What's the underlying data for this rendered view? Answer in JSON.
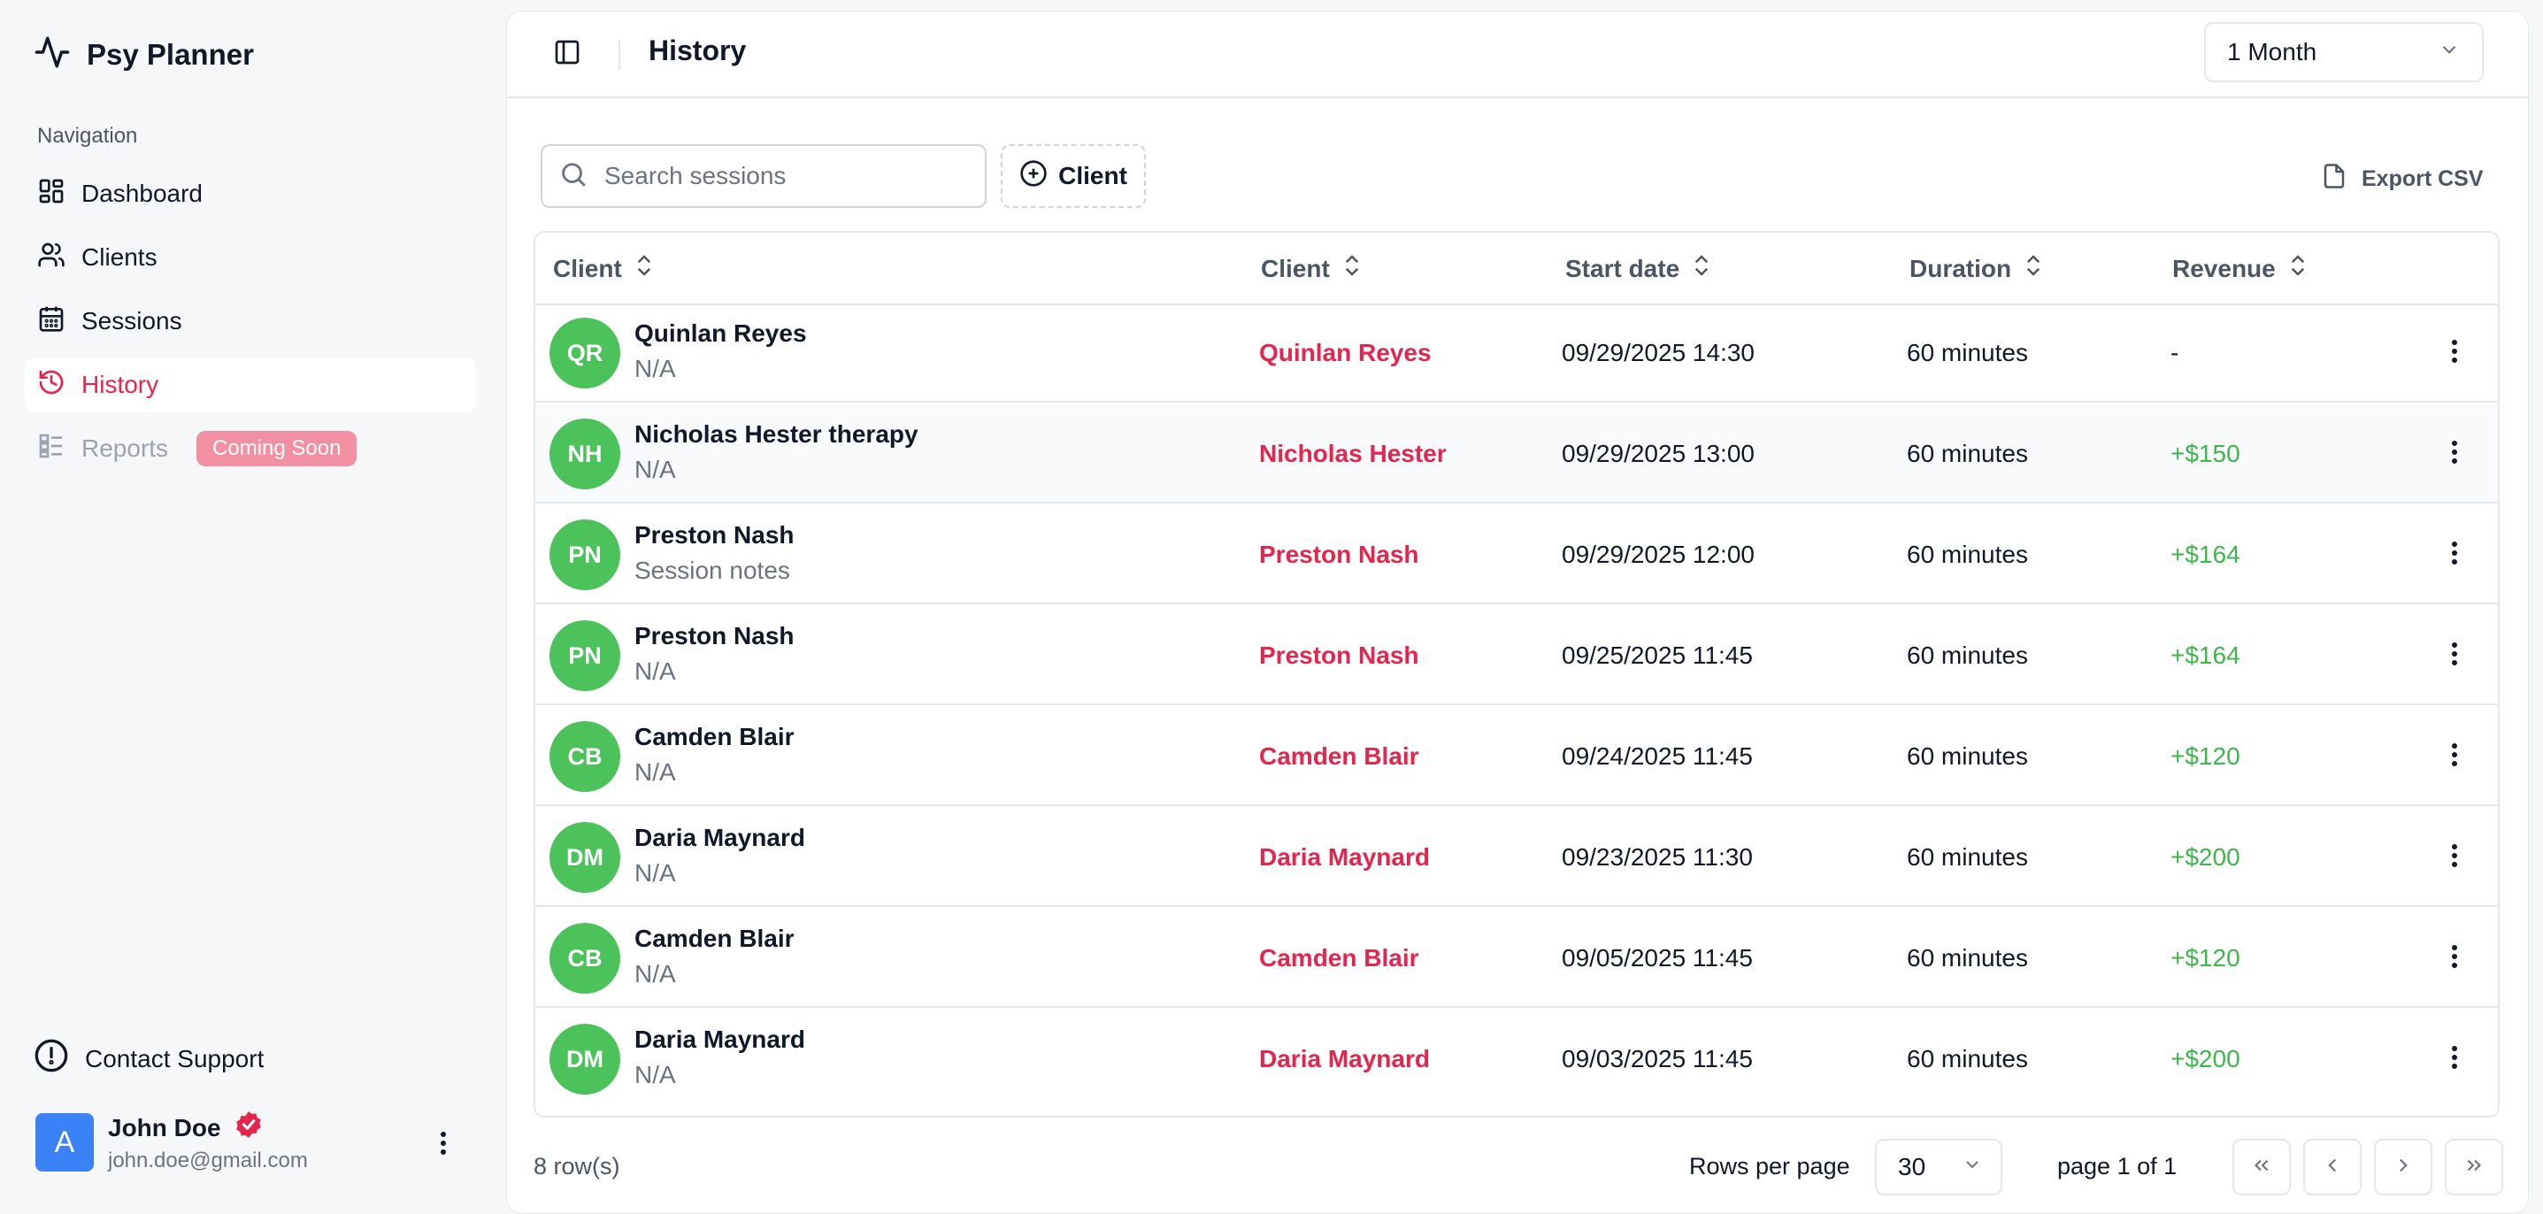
{
  "app": {
    "name": "Psy Planner"
  },
  "sidebar": {
    "heading": "Navigation",
    "items": [
      {
        "label": "Dashboard",
        "icon": "dashboard-icon"
      },
      {
        "label": "Clients",
        "icon": "users-icon"
      },
      {
        "label": "Sessions",
        "icon": "calendar-icon"
      },
      {
        "label": "History",
        "icon": "history-icon",
        "active": true
      },
      {
        "label": "Reports",
        "icon": "reports-icon",
        "disabled": true,
        "badge": "Coming Soon"
      }
    ],
    "support": "Contact Support",
    "user": {
      "initial": "A",
      "name": "John Doe",
      "email": "john.doe@gmail.com"
    }
  },
  "header": {
    "title": "History",
    "period": "1 Month"
  },
  "toolbar": {
    "search_placeholder": "Search sessions",
    "client_filter": "Client",
    "export": "Export CSV"
  },
  "table": {
    "columns": [
      "Client",
      "Client",
      "Start date",
      "Duration",
      "Revenue"
    ],
    "rows": [
      {
        "initials": "QR",
        "name": "Quinlan Reyes",
        "sub": "N/A",
        "client": "Quinlan Reyes",
        "date": "09/29/2025 14:30",
        "duration": "60 minutes",
        "revenue": "-"
      },
      {
        "initials": "NH",
        "name": "Nicholas Hester therapy",
        "sub": "N/A",
        "client": "Nicholas Hester",
        "date": "09/29/2025 13:00",
        "duration": "60 minutes",
        "revenue": "+$150"
      },
      {
        "initials": "PN",
        "name": "Preston Nash",
        "sub": "Session notes",
        "client": "Preston Nash",
        "date": "09/29/2025 12:00",
        "duration": "60 minutes",
        "revenue": "+$164"
      },
      {
        "initials": "PN",
        "name": "Preston Nash",
        "sub": "N/A",
        "client": "Preston Nash",
        "date": "09/25/2025 11:45",
        "duration": "60 minutes",
        "revenue": "+$164"
      },
      {
        "initials": "CB",
        "name": "Camden Blair",
        "sub": "N/A",
        "client": "Camden Blair",
        "date": "09/24/2025 11:45",
        "duration": "60 minutes",
        "revenue": "+$120"
      },
      {
        "initials": "DM",
        "name": "Daria Maynard",
        "sub": "N/A",
        "client": "Daria Maynard",
        "date": "09/23/2025 11:30",
        "duration": "60 minutes",
        "revenue": "+$200"
      },
      {
        "initials": "CB",
        "name": "Camden Blair",
        "sub": "N/A",
        "client": "Camden Blair",
        "date": "09/05/2025 11:45",
        "duration": "60 minutes",
        "revenue": "+$120"
      },
      {
        "initials": "DM",
        "name": "Daria Maynard",
        "sub": "N/A",
        "client": "Daria Maynard",
        "date": "09/03/2025 11:45",
        "duration": "60 minutes",
        "revenue": "+$200"
      }
    ]
  },
  "footer": {
    "count": "8 row(s)",
    "rows_per_page_label": "Rows per page",
    "rows_per_page": "30",
    "page_info": "page 1 of 1"
  },
  "colors": {
    "accent": "#e5254e",
    "positive": "#3fb54d",
    "avatar": "#4cc35a",
    "badge": "#f28fa3"
  }
}
